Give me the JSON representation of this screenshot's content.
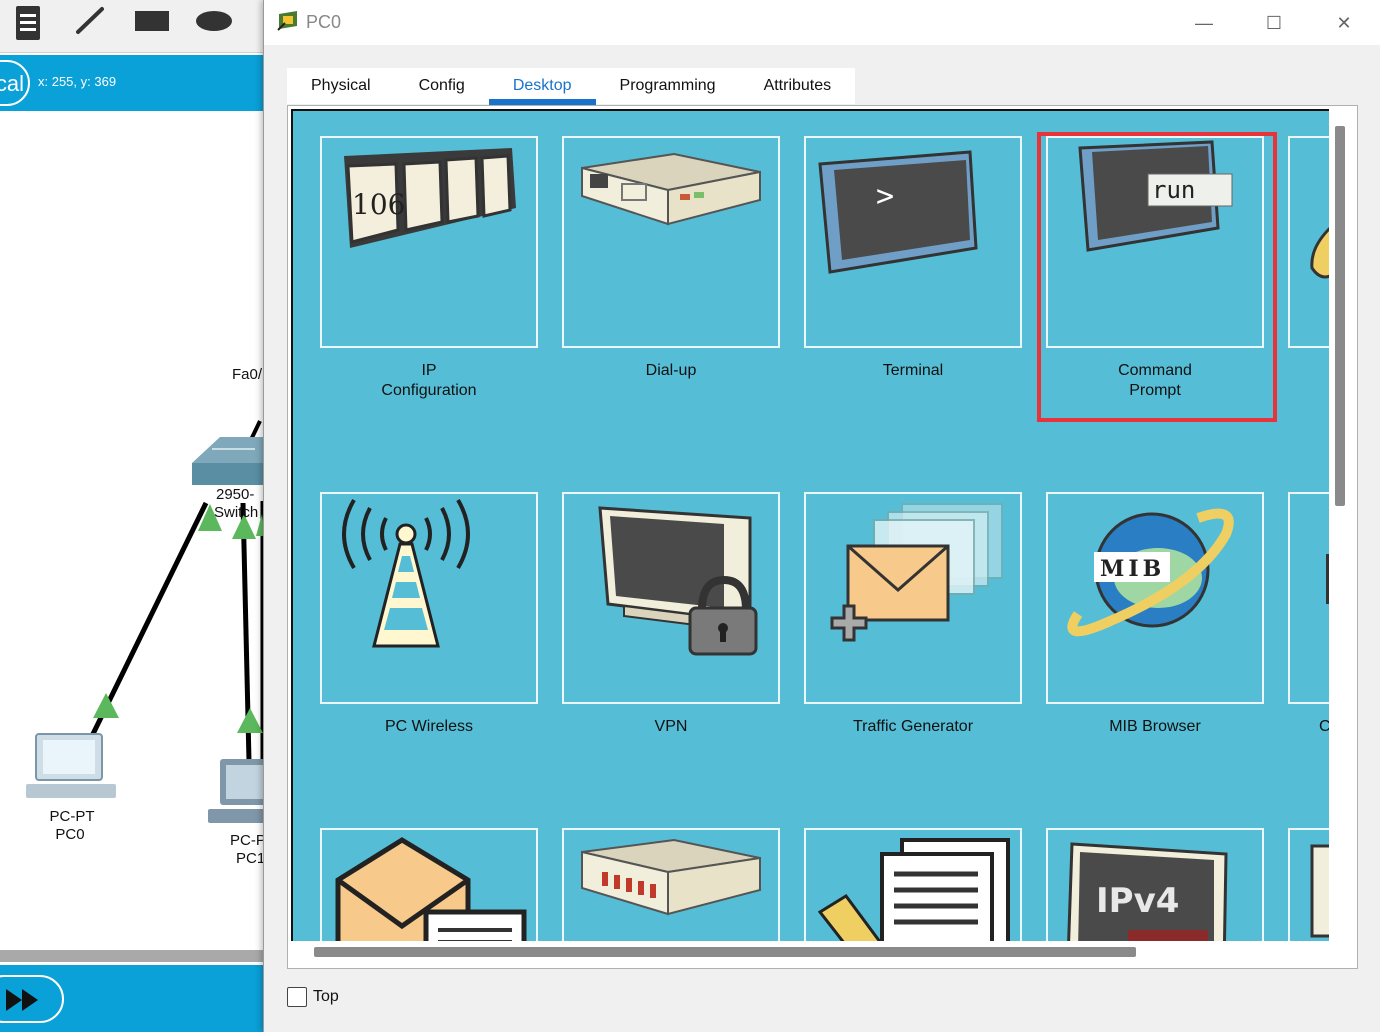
{
  "workspace": {
    "mode_label": "cal",
    "coordinates": "x: 255, y: 369",
    "port_label": "Fa0/",
    "switch_label_line1": "2950-",
    "switch_label_line2": "Switch",
    "devices": [
      {
        "type": "PC-PT",
        "name": "PC0"
      },
      {
        "type": "PC-P",
        "name": "PC1"
      }
    ]
  },
  "window": {
    "title": "PC0",
    "minimize": "—",
    "maximize": "☐",
    "close": "✕"
  },
  "tabs": [
    {
      "label": "Physical",
      "active": false
    },
    {
      "label": "Config",
      "active": false
    },
    {
      "label": "Desktop",
      "active": true
    },
    {
      "label": "Programming",
      "active": false
    },
    {
      "label": "Attributes",
      "active": false
    }
  ],
  "desktop": {
    "apps": [
      {
        "line1": "IP",
        "line2": "Configuration",
        "icon": "ip-config-icon"
      },
      {
        "line1": "Dial-up",
        "line2": "",
        "icon": "dialup-icon"
      },
      {
        "line1": "Terminal",
        "line2": "",
        "icon": "terminal-icon"
      },
      {
        "line1": "Command",
        "line2": "Prompt",
        "icon": "command-prompt-icon"
      },
      {
        "line1": "PC Wireless",
        "line2": "",
        "icon": "wireless-tower-icon"
      },
      {
        "line1": "VPN",
        "line2": "",
        "icon": "vpn-lock-icon"
      },
      {
        "line1": "Traffic Generator",
        "line2": "",
        "icon": "traffic-generator-icon"
      },
      {
        "line1": "MIB Browser",
        "line2": "",
        "icon": "mib-browser-icon"
      },
      {
        "line1": "Ci",
        "line2": "",
        "icon": "partial-icon"
      }
    ],
    "icon_text": {
      "ip_config_number": "106",
      "run_text": "run",
      "terminal_prompt": ">",
      "mib_text": "MIB",
      "ipv4_text": "IPv4"
    }
  },
  "footer": {
    "top_label": "Top",
    "top_checked": false
  },
  "colors": {
    "accent": "#1a73c8",
    "desktop_bg": "#55bed6",
    "highlight": "#e8333a",
    "pt_blue": "#0aa0d8"
  }
}
